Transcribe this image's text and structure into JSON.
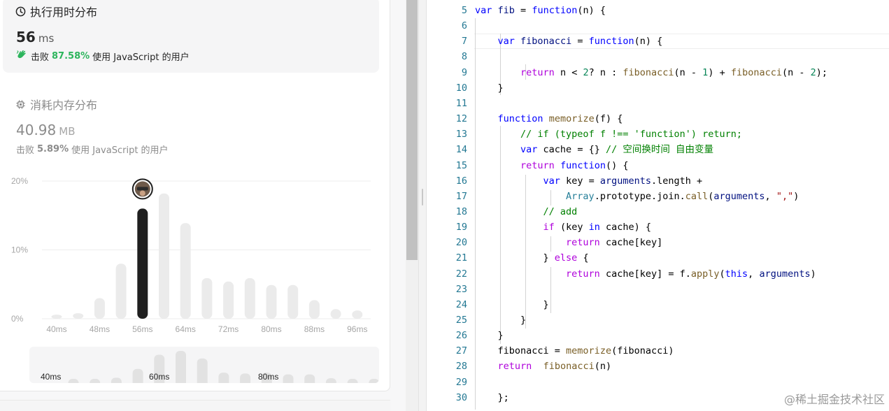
{
  "runtime": {
    "title": "执行用时分布",
    "value": "56",
    "unit": "ms",
    "beats_prefix": "击败",
    "beats_pct": "87.58%",
    "beats_suffix": "使用 JavaScript 的用户",
    "title_icon": "clock-icon",
    "beats_icon": "clapping-hands-icon"
  },
  "memory": {
    "title": "消耗内存分布",
    "value": "40.98",
    "unit": "MB",
    "beats_prefix": "击败",
    "beats_pct": "5.89%",
    "beats_suffix": "使用 JavaScript 的用户",
    "title_icon": "chip-icon"
  },
  "chart_data": [
    {
      "type": "bar",
      "title": "",
      "categories": [
        "40ms",
        "44ms",
        "48ms",
        "52ms",
        "56ms",
        "60ms",
        "64ms",
        "68ms",
        "72ms",
        "76ms",
        "80ms",
        "84ms",
        "88ms",
        "92ms",
        "96ms"
      ],
      "values": [
        0.6,
        0.8,
        3.0,
        8.0,
        16.0,
        18.2,
        13.9,
        5.9,
        5.4,
        5.9,
        4.9,
        4.9,
        2.7,
        1.4,
        1.2
      ],
      "ylim": [
        0,
        20
      ],
      "y_ticks": [
        "0%",
        "10%",
        "20%"
      ],
      "x_tick_labels": [
        "40ms",
        "48ms",
        "56ms",
        "64ms",
        "72ms",
        "80ms",
        "88ms",
        "96ms"
      ],
      "highlight_category": "56ms",
      "highlight_color": "#1f1f1f",
      "bar_color": "#ebebeb",
      "marker": "user-avatar",
      "grid": true
    },
    {
      "type": "bar",
      "title": "",
      "values": [
        0.6,
        0.8,
        3.0,
        8.0,
        16.0,
        18.2,
        13.9,
        5.9,
        5.4,
        5.9,
        4.9,
        4.9,
        2.7,
        1.4,
        1.2
      ],
      "x_tick_labels": [
        "40ms",
        "60ms",
        "80ms"
      ],
      "bar_color": "#e2e2e2"
    }
  ],
  "editor": {
    "lines": [
      {
        "n": "5",
        "tokens": [
          [
            "kw",
            "var"
          ],
          [
            "pl",
            " "
          ],
          [
            "fn",
            "fib"
          ],
          [
            "pl",
            " = "
          ],
          [
            "kw",
            "function"
          ],
          [
            "pl",
            "(n) {"
          ]
        ]
      },
      {
        "n": "6",
        "tokens": []
      },
      {
        "n": "7",
        "tokens": [
          [
            "pl",
            "    "
          ],
          [
            "kw",
            "var"
          ],
          [
            "pl",
            " "
          ],
          [
            "fn",
            "fibonacci"
          ],
          [
            "pl",
            " = "
          ],
          [
            "kw",
            "function"
          ],
          [
            "pl",
            "(n) {"
          ]
        ]
      },
      {
        "n": "8",
        "tokens": []
      },
      {
        "n": "9",
        "tokens": [
          [
            "pl",
            "        "
          ],
          [
            "ctl",
            "return"
          ],
          [
            "pl",
            " n < "
          ],
          [
            "num",
            "2"
          ],
          [
            "pl",
            "? n : "
          ],
          [
            "fc",
            "fibonacci"
          ],
          [
            "pl",
            "(n - "
          ],
          [
            "num",
            "1"
          ],
          [
            "pl",
            ") + "
          ],
          [
            "fc",
            "fibonacci"
          ],
          [
            "pl",
            "(n - "
          ],
          [
            "num",
            "2"
          ],
          [
            "pl",
            ");"
          ]
        ]
      },
      {
        "n": "10",
        "tokens": [
          [
            "pl",
            "    }"
          ]
        ]
      },
      {
        "n": "11",
        "tokens": []
      },
      {
        "n": "12",
        "tokens": [
          [
            "pl",
            "    "
          ],
          [
            "kw",
            "function"
          ],
          [
            "pl",
            " "
          ],
          [
            "fc",
            "memorize"
          ],
          [
            "pl",
            "(f) {"
          ]
        ]
      },
      {
        "n": "13",
        "tokens": [
          [
            "pl",
            "        "
          ],
          [
            "cm",
            "// if (typeof f !== 'function') return;"
          ]
        ]
      },
      {
        "n": "14",
        "tokens": [
          [
            "pl",
            "        "
          ],
          [
            "kw",
            "var"
          ],
          [
            "pl",
            " cache = {} "
          ],
          [
            "cm",
            "// 空间换时间 自由变量"
          ]
        ]
      },
      {
        "n": "15",
        "tokens": [
          [
            "pl",
            "        "
          ],
          [
            "ctl",
            "return"
          ],
          [
            "pl",
            " "
          ],
          [
            "kw",
            "function"
          ],
          [
            "pl",
            "() {"
          ]
        ]
      },
      {
        "n": "16",
        "tokens": [
          [
            "pl",
            "            "
          ],
          [
            "kw",
            "var"
          ],
          [
            "pl",
            " key = "
          ],
          [
            "fn",
            "arguments"
          ],
          [
            "pl",
            ".length +"
          ]
        ]
      },
      {
        "n": "17",
        "tokens": [
          [
            "pl",
            "                "
          ],
          [
            "ty",
            "Array"
          ],
          [
            "pl",
            ".prototype.join."
          ],
          [
            "fc",
            "call"
          ],
          [
            "pl",
            "("
          ],
          [
            "fn",
            "arguments"
          ],
          [
            "pl",
            ", "
          ],
          [
            "str",
            "\",\""
          ],
          [
            "pl",
            ")"
          ]
        ]
      },
      {
        "n": "18",
        "tokens": [
          [
            "pl",
            "            "
          ],
          [
            "cm",
            "// add"
          ]
        ]
      },
      {
        "n": "19",
        "tokens": [
          [
            "pl",
            "            "
          ],
          [
            "ctl",
            "if"
          ],
          [
            "pl",
            " (key "
          ],
          [
            "kw",
            "in"
          ],
          [
            "pl",
            " cache) {"
          ]
        ]
      },
      {
        "n": "20",
        "tokens": [
          [
            "pl",
            "                "
          ],
          [
            "ctl",
            "return"
          ],
          [
            "pl",
            " cache[key]"
          ]
        ]
      },
      {
        "n": "21",
        "tokens": [
          [
            "pl",
            "            } "
          ],
          [
            "ctl",
            "else"
          ],
          [
            "pl",
            " {"
          ]
        ]
      },
      {
        "n": "22",
        "tokens": [
          [
            "pl",
            "                "
          ],
          [
            "ctl",
            "return"
          ],
          [
            "pl",
            " cache[key] = f."
          ],
          [
            "fc",
            "apply"
          ],
          [
            "pl",
            "("
          ],
          [
            "kw",
            "this"
          ],
          [
            "pl",
            ", "
          ],
          [
            "fn",
            "arguments"
          ],
          [
            "pl",
            ")"
          ]
        ]
      },
      {
        "n": "23",
        "tokens": []
      },
      {
        "n": "24",
        "tokens": [
          [
            "pl",
            "            }"
          ]
        ]
      },
      {
        "n": "25",
        "tokens": [
          [
            "pl",
            "        }"
          ]
        ]
      },
      {
        "n": "26",
        "tokens": [
          [
            "pl",
            "    }"
          ]
        ]
      },
      {
        "n": "27",
        "tokens": [
          [
            "pl",
            "    fibonacci = "
          ],
          [
            "fc",
            "memorize"
          ],
          [
            "pl",
            "(fibonacci)"
          ]
        ]
      },
      {
        "n": "28",
        "tokens": [
          [
            "pl",
            "    "
          ],
          [
            "ctl",
            "return"
          ],
          [
            "pl",
            "  "
          ],
          [
            "fc",
            "fibonacci"
          ],
          [
            "pl",
            "(n)"
          ]
        ]
      },
      {
        "n": "29",
        "tokens": []
      },
      {
        "n": "30",
        "tokens": [
          [
            "pl",
            "    };"
          ]
        ]
      }
    ]
  },
  "watermark": "@稀土掘金技术社区"
}
